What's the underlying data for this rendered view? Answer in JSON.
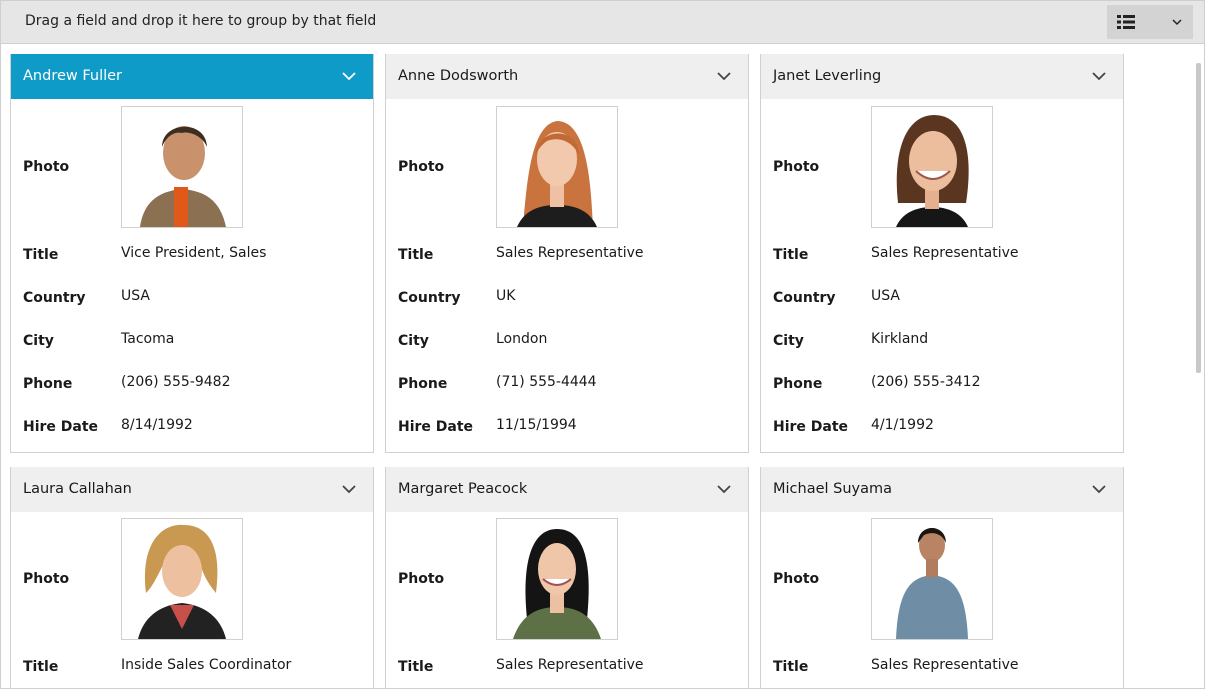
{
  "group_bar": {
    "text": "Drag a field and drop it here to group by that field",
    "view_icon": "list-view-icon",
    "dropdown_icon": "chevron-down-icon"
  },
  "field_labels": {
    "photo": "Photo",
    "title": "Title",
    "country": "Country",
    "city": "City",
    "phone": "Phone",
    "hire_date": "Hire Date"
  },
  "colors": {
    "selected_header": "#0e9bc7",
    "header": "#efefef"
  },
  "cards": [
    {
      "name": "Andrew  Fuller",
      "selected": true,
      "title": "Vice President, Sales",
      "country": "USA",
      "city": "Tacoma",
      "phone": "(206) 555-9482",
      "hire_date": "8/14/1992"
    },
    {
      "name": "Anne  Dodsworth",
      "selected": false,
      "title": "Sales Representative",
      "country": "UK",
      "city": "London",
      "phone": "(71) 555-4444",
      "hire_date": "11/15/1994"
    },
    {
      "name": "Janet  Leverling",
      "selected": false,
      "title": "Sales Representative",
      "country": "USA",
      "city": "Kirkland",
      "phone": "(206) 555-3412",
      "hire_date": "4/1/1992"
    },
    {
      "name": "Laura  Callahan",
      "selected": false,
      "title": "Inside Sales Coordinator"
    },
    {
      "name": "Margaret  Peacock",
      "selected": false,
      "title": "Sales Representative"
    },
    {
      "name": "Michael  Suyama",
      "selected": false,
      "title": "Sales Representative"
    }
  ]
}
